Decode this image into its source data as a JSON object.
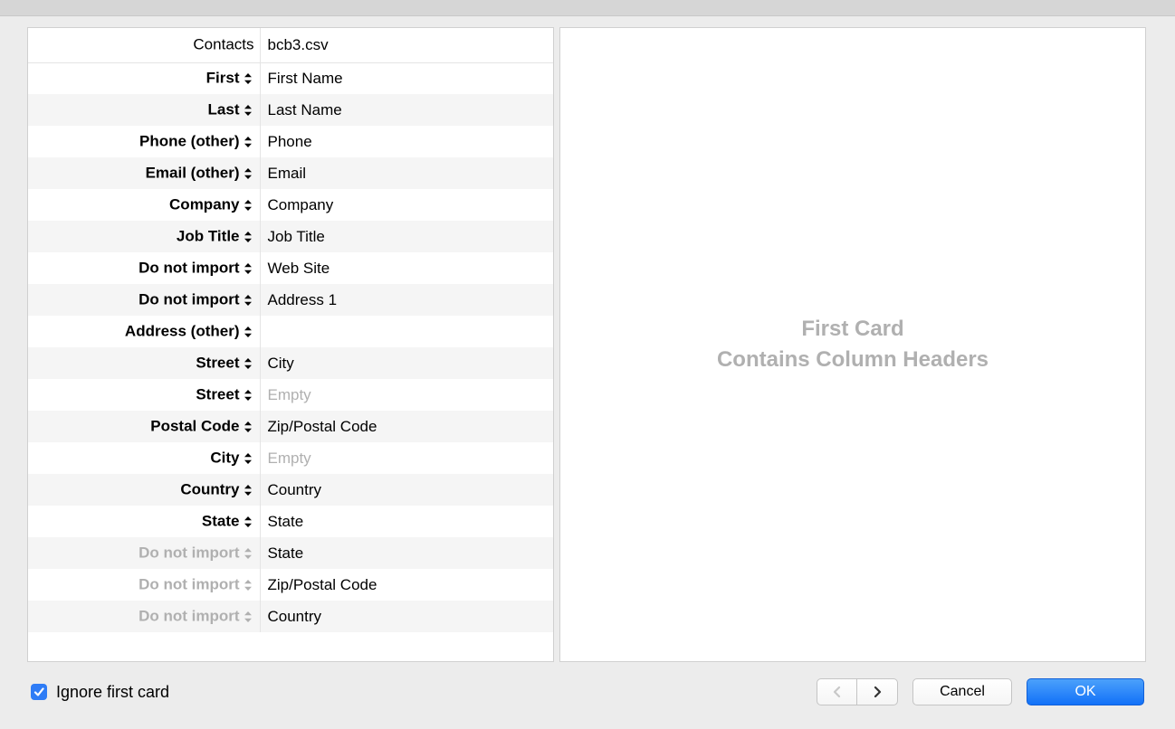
{
  "header": {
    "contacts_label": "Contacts",
    "file_label": "bcb3.csv"
  },
  "rows": [
    {
      "field": "First",
      "value": "First Name",
      "bold": true,
      "disabled": false,
      "empty": false
    },
    {
      "field": "Last",
      "value": "Last Name",
      "bold": true,
      "disabled": false,
      "empty": false
    },
    {
      "field": "Phone (other)",
      "value": "Phone",
      "bold": true,
      "disabled": false,
      "empty": false
    },
    {
      "field": "Email (other)",
      "value": "Email",
      "bold": true,
      "disabled": false,
      "empty": false
    },
    {
      "field": "Company",
      "value": "Company",
      "bold": true,
      "disabled": false,
      "empty": false
    },
    {
      "field": "Job Title",
      "value": "Job Title",
      "bold": true,
      "disabled": false,
      "empty": false
    },
    {
      "field": "Do not import",
      "value": "Web Site",
      "bold": true,
      "disabled": false,
      "empty": false
    },
    {
      "field": "Do not import",
      "value": "Address 1",
      "bold": true,
      "disabled": false,
      "empty": false
    },
    {
      "field": "Address (other)",
      "value": "",
      "bold": true,
      "disabled": false,
      "empty": false
    },
    {
      "field": "Street",
      "value": "City",
      "bold": true,
      "disabled": false,
      "empty": false
    },
    {
      "field": "Street",
      "value": "Empty",
      "bold": true,
      "disabled": false,
      "empty": true
    },
    {
      "field": "Postal Code",
      "value": "Zip/Postal Code",
      "bold": true,
      "disabled": false,
      "empty": false
    },
    {
      "field": "City",
      "value": "Empty",
      "bold": true,
      "disabled": false,
      "empty": true
    },
    {
      "field": "Country",
      "value": "Country",
      "bold": true,
      "disabled": false,
      "empty": false
    },
    {
      "field": "State",
      "value": "State",
      "bold": true,
      "disabled": false,
      "empty": false
    },
    {
      "field": "Do not import",
      "value": "State",
      "bold": true,
      "disabled": true,
      "empty": false
    },
    {
      "field": "Do not import",
      "value": "Zip/Postal Code",
      "bold": true,
      "disabled": true,
      "empty": false
    },
    {
      "field": "Do not import",
      "value": "Country",
      "bold": true,
      "disabled": true,
      "empty": false
    }
  ],
  "preview": {
    "line1": "First Card",
    "line2": "Contains Column Headers"
  },
  "footer": {
    "checkbox_label": "Ignore first card",
    "checkbox_checked": true,
    "cancel_label": "Cancel",
    "ok_label": "OK"
  }
}
